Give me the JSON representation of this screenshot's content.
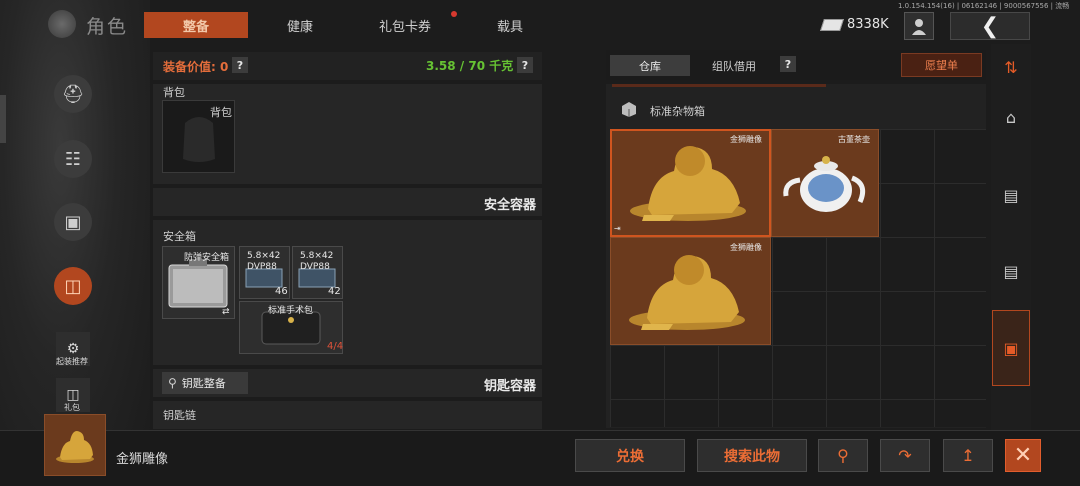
{
  "header": {
    "title": "角色",
    "tabs": [
      {
        "label": "整备",
        "active": true
      },
      {
        "label": "健康",
        "active": false
      },
      {
        "label": "礼包卡券",
        "active": false,
        "badge": true
      },
      {
        "label": "载具",
        "active": false
      }
    ],
    "version": "1.0.154.154(16) | 06162146 | 9000567556 | 流畅",
    "money": "8338K"
  },
  "sidebar": {
    "items": [
      {
        "icon": "helmet-icon",
        "active": false
      },
      {
        "icon": "vest-icon",
        "active": false
      },
      {
        "icon": "backpack-icon",
        "active": false
      },
      {
        "icon": "toolbox-icon",
        "active": true
      }
    ],
    "loadout_label": "起装推荐",
    "gift_label": "礼包"
  },
  "equipment": {
    "value_label": "装备价值: 0",
    "weight": "3.58 / 70 千克",
    "backpack_section": "背包",
    "backpack_slot_label": "背包",
    "safe_container_title": "安全容器",
    "safe_box_section": "安全箱",
    "safe_items": [
      {
        "name": "防弹安全箱",
        "badge": "⇄"
      },
      {
        "name": "5.8×42\nDVP88",
        "count": "46"
      },
      {
        "name": "5.8×42\nDVP88",
        "count": "42"
      },
      {
        "name": "标准手术包",
        "count": "4/4"
      }
    ],
    "key_button": "钥匙整备",
    "key_container_title": "钥匙容器",
    "keychain_section": "钥匙链"
  },
  "warehouse": {
    "tabs": [
      {
        "label": "仓库",
        "active": true
      },
      {
        "label": "组队借用",
        "active": false
      }
    ],
    "wishlist_button": "愿望单",
    "container_name": "标准杂物箱",
    "items": [
      {
        "name": "金狮雕像",
        "type": "lion",
        "selected": true
      },
      {
        "name": "古董茶壶",
        "type": "teapot",
        "selected": false
      },
      {
        "name": "金狮雕像",
        "type": "lion",
        "selected": false
      }
    ]
  },
  "rail": {
    "items": [
      {
        "icon": "sort-icon"
      },
      {
        "icon": "home-icon"
      },
      {
        "icon": "storage-box-icon"
      },
      {
        "icon": "storage-box-icon"
      },
      {
        "icon": "sundries-box-icon",
        "active": true
      }
    ]
  },
  "bottom": {
    "selected_item": "金狮雕像",
    "exchange_button": "兑换",
    "search_button": "搜索此物"
  },
  "colors": {
    "accent": "#b2471f",
    "item_bg": "#6b3a1d",
    "weight_green": "#66c233"
  }
}
